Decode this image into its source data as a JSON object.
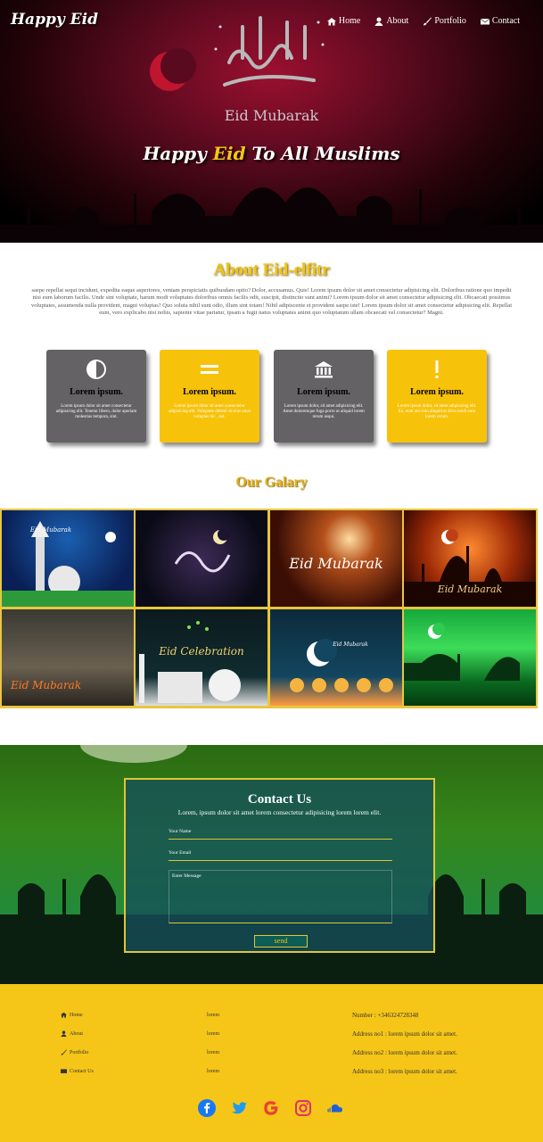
{
  "brand": "Happy Eid",
  "nav": [
    {
      "label": "Home",
      "icon": "home-icon"
    },
    {
      "label": "About",
      "icon": "user-icon"
    },
    {
      "label": "Portfolio",
      "icon": "brush-icon"
    },
    {
      "label": "Contact",
      "icon": "envelope-icon"
    }
  ],
  "hero": {
    "caption": "Eid Mubarak",
    "tagline_pre": "Happy ",
    "tagline_accent": "Eid",
    "tagline_post": " To All Muslims"
  },
  "about": {
    "title": "About Eid-elfitr",
    "text": "saepe repellat sequi incidunt, expedita eaque asperiores, veniam perspiciatis quibusdam optio? Dolor, accusamus. Quis! Lorem ipsum dolor sit amet consectetur adipisicing elit. Doloribus ratione quo impedit nisi eum laborum facilis. Unde sint voluptate, harum modi voluptates doloribus omnis facilis odit, suscipit, distinctio sunt animi? Lorem ipsum dolor sit amet consectetur adipisicing elit. Obcaecati possimus voluptates, assumenda nulla provident, magni voluptas? Quo soluta nihil sunt odio, illum sint totam! Nihil adipiscente et provident saepe iste! Lorem ipsum dolor sit amet consectetur adipisicing elit. Repellat eum, vero explicabo nisi nobis, sapiente vitae pariatur, ipsam a fugit natus voluptates animi quo voluptatum ullam obcaecati vel consectetur? Magni."
  },
  "cards": [
    {
      "title": "Lorem ipsum.",
      "text": "Lorem ipsum dolor sit amet consectetur adipisicing elit. Tenetur libero, dolor aperiam molestias tempora, sint.",
      "style": "gray",
      "icon": "half-circle-icon"
    },
    {
      "title": "Lorem ipsum.",
      "text": "Lorem ipsum dolor sit amet consectetur adipisicing elit. Voluptate delenit sit eius amet voluptas hic , aut.",
      "style": "yellow",
      "icon": "equals-icon"
    },
    {
      "title": "Lorem ipsum.",
      "text": "Lorem ipsum dolor, sit amet adipisicing elit. Amet doloremque fuga porro ut aliquid lorem rerum sequi.",
      "style": "gray",
      "icon": "bank-icon"
    },
    {
      "title": "Lorem ipsum.",
      "text": "Lorem ipsum dolor, sit amet adipisicing elit. Ex, eum aut cum aliquid et dicta modi eum lorem rerum.",
      "style": "yellow",
      "icon": "exclamation-icon"
    }
  ],
  "gallery": {
    "title": "Our Galary",
    "captions": [
      "Eid Mubarak",
      "",
      "Eid Mubarak",
      "Eid Mubarak",
      "Eid Mubarak",
      "Eid Celebration",
      "Eid Mubarak",
      ""
    ]
  },
  "contact": {
    "title": "Contact Us",
    "subtitle": "Lorem, ipsum dolor sit amet lorem consectetur adipisicing lorem lorem elit.",
    "name_placeholder": "Your Name",
    "email_placeholder": "Your Email",
    "message_placeholder": "Enter Message",
    "send": "send"
  },
  "footer": {
    "links": [
      "Home",
      "About",
      "Portfolio",
      "Contact Us"
    ],
    "middle": [
      "lorem",
      "lorem",
      "lorem",
      "lorem"
    ],
    "info": [
      "Number : +346324728348",
      "Address no1 : lorem ipsum dolor sit amet.",
      "Address no2 : lorem ipsum dolor sit amet.",
      "Address no3 : lorem ipsum dolor sit amet."
    ]
  },
  "colors": {
    "accent": "#f5c518",
    "card_gray": "#646264"
  }
}
